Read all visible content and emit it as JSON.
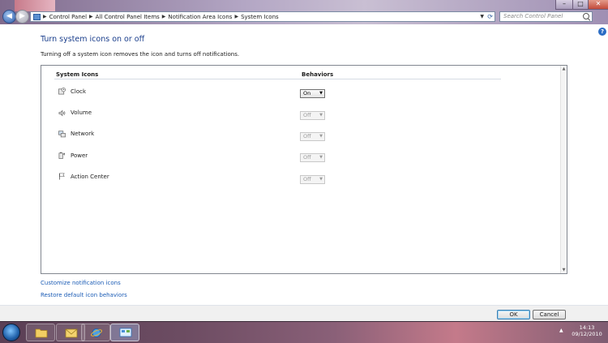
{
  "address_bar": {
    "crumbs": [
      "Control Panel",
      "All Control Panel Items",
      "Notification Area Icons",
      "System Icons"
    ],
    "search_placeholder": "Search Control Panel"
  },
  "page": {
    "title": "Turn system icons on or off",
    "description": "Turning off a system icon removes the icon and turns off notifications."
  },
  "table": {
    "col_icons": "System Icons",
    "col_behaviors": "Behaviors",
    "rows": [
      {
        "label": "Clock",
        "icon": "clock-icon",
        "behavior": "On",
        "enabled": true
      },
      {
        "label": "Volume",
        "icon": "volume-icon",
        "behavior": "Off",
        "enabled": false
      },
      {
        "label": "Network",
        "icon": "network-icon",
        "behavior": "Off",
        "enabled": false
      },
      {
        "label": "Power",
        "icon": "power-icon",
        "behavior": "Off",
        "enabled": false
      },
      {
        "label": "Action Center",
        "icon": "flag-icon",
        "behavior": "Off",
        "enabled": false
      }
    ]
  },
  "links": {
    "customize": "Customize notification icons",
    "restore": "Restore default icon behaviors"
  },
  "buttons": {
    "ok": "OK",
    "cancel": "Cancel"
  },
  "taskbar": {
    "time": "14:13",
    "date": "09/12/2010"
  },
  "colors": {
    "link": "#1a5bb5",
    "title": "#1a3e8c"
  }
}
